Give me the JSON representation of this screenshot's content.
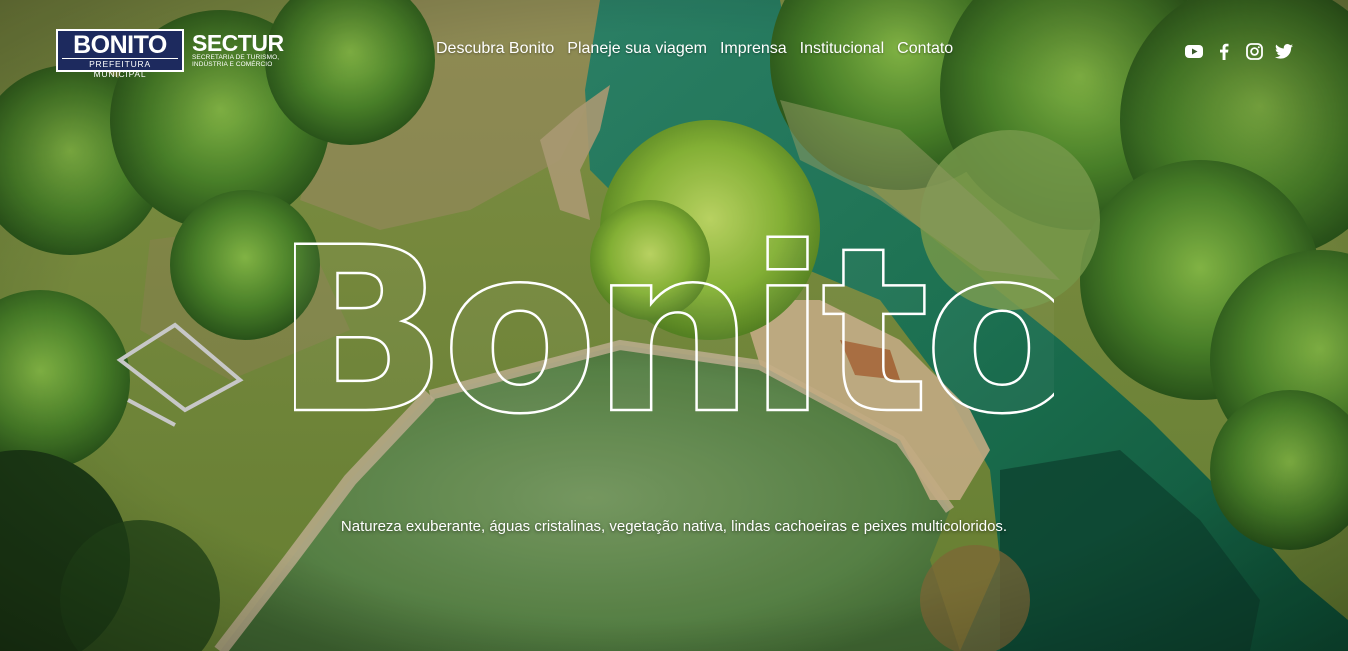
{
  "logos": {
    "prefeitura": {
      "name": "BONITO",
      "subtitle": "PREFEITURA MUNICIPAL"
    },
    "sectur": {
      "name": "SECTUR",
      "subtitle_line1": "Secretaria de Turismo,",
      "subtitle_line2": "Indústria e Comércio"
    }
  },
  "nav": {
    "items": [
      {
        "label": "Descubra Bonito"
      },
      {
        "label": "Planeje sua viagem"
      },
      {
        "label": "Imprensa"
      },
      {
        "label": "Institucional"
      },
      {
        "label": "Contato"
      }
    ]
  },
  "social": [
    "youtube-icon",
    "facebook-icon",
    "instagram-icon",
    "twitter-icon"
  ],
  "hero": {
    "title": "Bonito",
    "tagline": "Natureza exuberante, águas cristalinas, vegetação nativa, lindas cachoeiras e peixes multicoloridos."
  },
  "colors": {
    "brand_navy": "#1d2a5e",
    "text": "#ffffff"
  }
}
